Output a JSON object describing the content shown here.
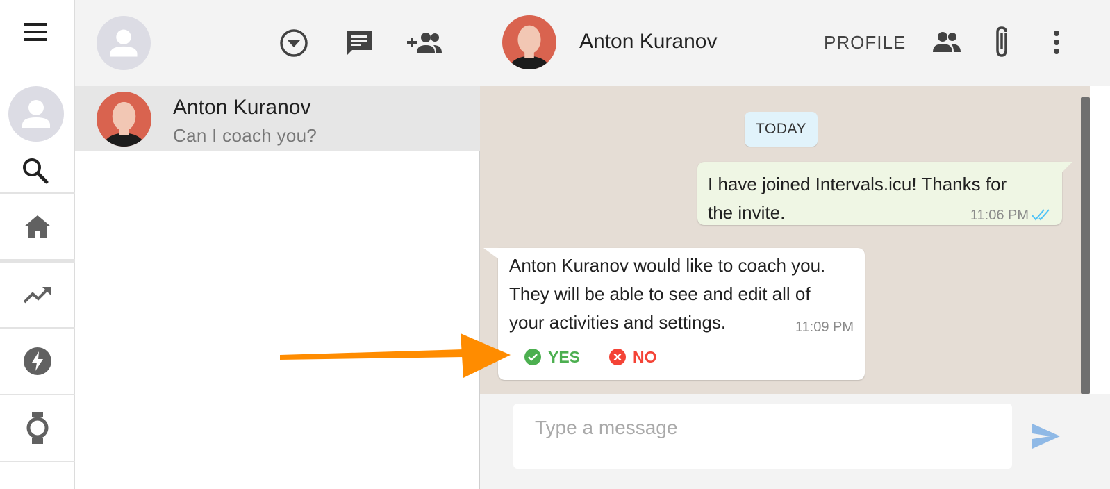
{
  "colors": {
    "arrow": "#ff8c00",
    "yes": "#4caf50",
    "no": "#f44336",
    "tick": "#4fc3f7",
    "send": "#8fb9e6",
    "chat_bg": "#e5ddd5",
    "outgoing_bubble": "#eff6e4"
  },
  "sidebar": {
    "icons": [
      "menu-icon",
      "avatar-icon",
      "search-icon",
      "home-icon",
      "trending-icon",
      "bolt-icon",
      "watch-icon"
    ]
  },
  "chat_list": {
    "header_icons": [
      "dropdown-icon",
      "new-chat-icon",
      "add-group-icon"
    ],
    "items": [
      {
        "name": "Anton Kuranov",
        "preview": "Can I coach you?"
      }
    ]
  },
  "conversation": {
    "contact_name": "Anton Kuranov",
    "profile_label": "PROFILE",
    "header_icons": [
      "group-icon",
      "attach-icon",
      "more-icon"
    ],
    "date_divider": "TODAY",
    "messages": [
      {
        "direction": "outgoing",
        "text": "I have joined Intervals.icu! Thanks for the invite.",
        "time": "11:06 PM",
        "status": "read"
      },
      {
        "direction": "incoming",
        "text": "Anton Kuranov would like to coach you. They will be able to see and edit all of your activities and settings.",
        "time": "11:09 PM",
        "actions": {
          "yes": "YES",
          "no": "NO"
        }
      }
    ],
    "composer": {
      "placeholder": "Type a message"
    }
  }
}
